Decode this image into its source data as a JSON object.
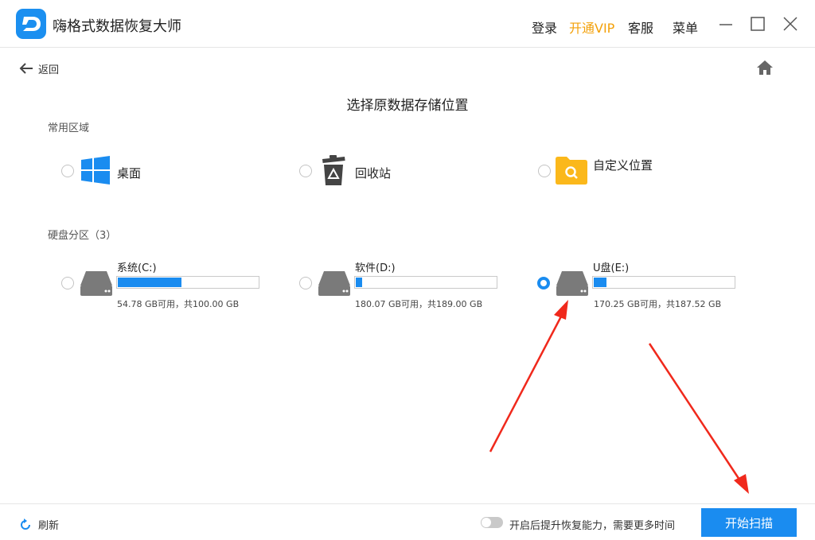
{
  "app": {
    "title": "嗨格式数据恢复大师"
  },
  "header": {
    "login": "登录",
    "vip": "开通VIP",
    "service": "客服",
    "menu": "菜单"
  },
  "nav": {
    "back": "返回"
  },
  "page": {
    "title": "选择原数据存储位置"
  },
  "common_section": {
    "label": "常用区域",
    "items": [
      {
        "label": "桌面",
        "icon": "windows-icon",
        "selected": false
      },
      {
        "label": "回收站",
        "icon": "recycle-bin-icon",
        "selected": false
      },
      {
        "label": "自定义位置",
        "icon": "folder-search-icon",
        "selected": false
      }
    ]
  },
  "disk_section": {
    "label": "硬盘分区（3）",
    "drives": [
      {
        "name": "系统(C:)",
        "info": "54.78 GB可用，共100.00 GB",
        "used_fraction": 0.452,
        "selected": false
      },
      {
        "name": "软件(D:)",
        "info": "180.07 GB可用，共189.00 GB",
        "used_fraction": 0.047,
        "selected": false
      },
      {
        "name": "U盘(E:)",
        "info": "170.25 GB可用，共187.52 GB",
        "used_fraction": 0.092,
        "selected": true
      }
    ]
  },
  "footer": {
    "refresh": "刷新",
    "toggle_label": "开启后提升恢复能力，需要更多时间",
    "toggle_on": false,
    "start": "开始扫描"
  },
  "colors": {
    "accent": "#1a8cf0",
    "vip": "#f3a10a",
    "annotation": "#f0291c"
  }
}
